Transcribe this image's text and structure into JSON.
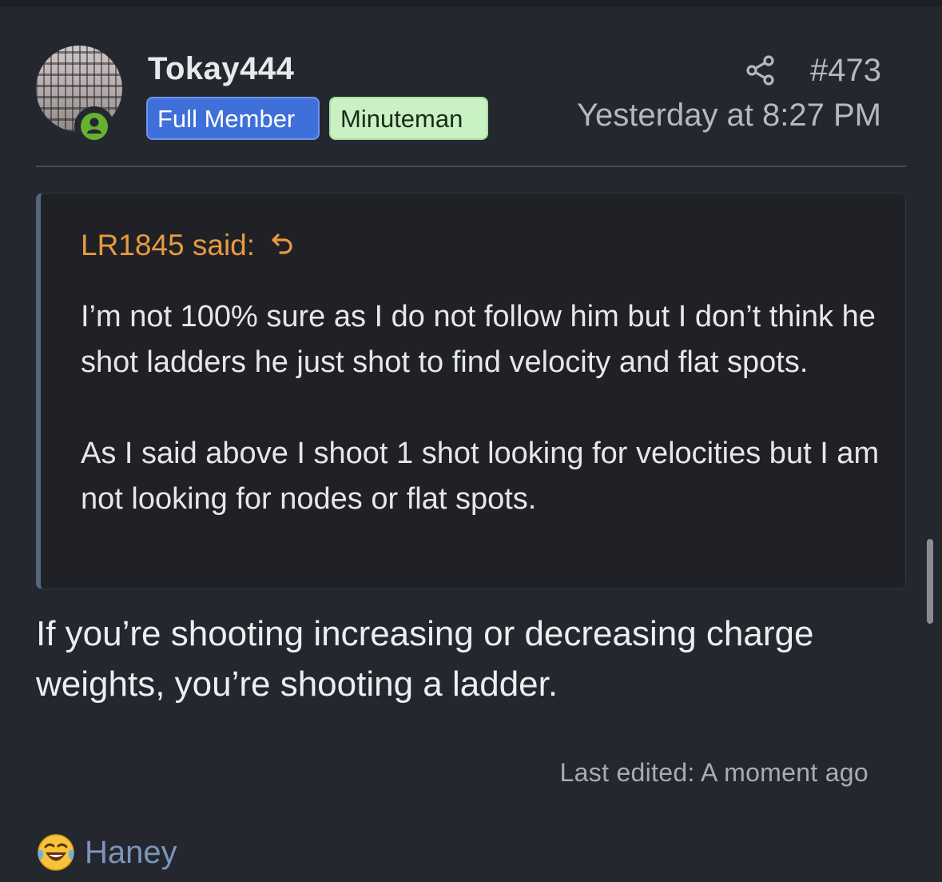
{
  "post": {
    "author": "Tokay444",
    "badges": [
      "Full Member",
      "Minuteman"
    ],
    "post_number": "#473",
    "timestamp": "Yesterday at 8:27 PM",
    "quote": {
      "author_line": "LR1845 said:",
      "paragraphs": [
        "I’m not 100% sure as I do not follow him but I don’t think he shot ladders he just shot to find velocity and flat spots.",
        "As I said above I shoot 1 shot looking for velocities but I am not looking for nodes or flat spots."
      ]
    },
    "body": "If you’re shooting increasing or decreasing charge weights, you’re shooting a ladder.",
    "last_edited": "Last edited: A moment ago",
    "reaction": {
      "icon": "laughing-tears-emoji-icon",
      "name": "Haney"
    }
  },
  "colors": {
    "background": "#25272e",
    "page_edge": "#1d1f24",
    "quote_background": "#1f2126",
    "quote_accent": "#54657d",
    "quote_author": "#e79a3f",
    "badge_full_member": "#3f6fd8",
    "badge_minuteman": "#c9f1c4",
    "online_indicator": "#66b032",
    "reaction_name": "#7b94b8",
    "text": "#e6e7ea",
    "muted_text": "#b6b8be"
  }
}
